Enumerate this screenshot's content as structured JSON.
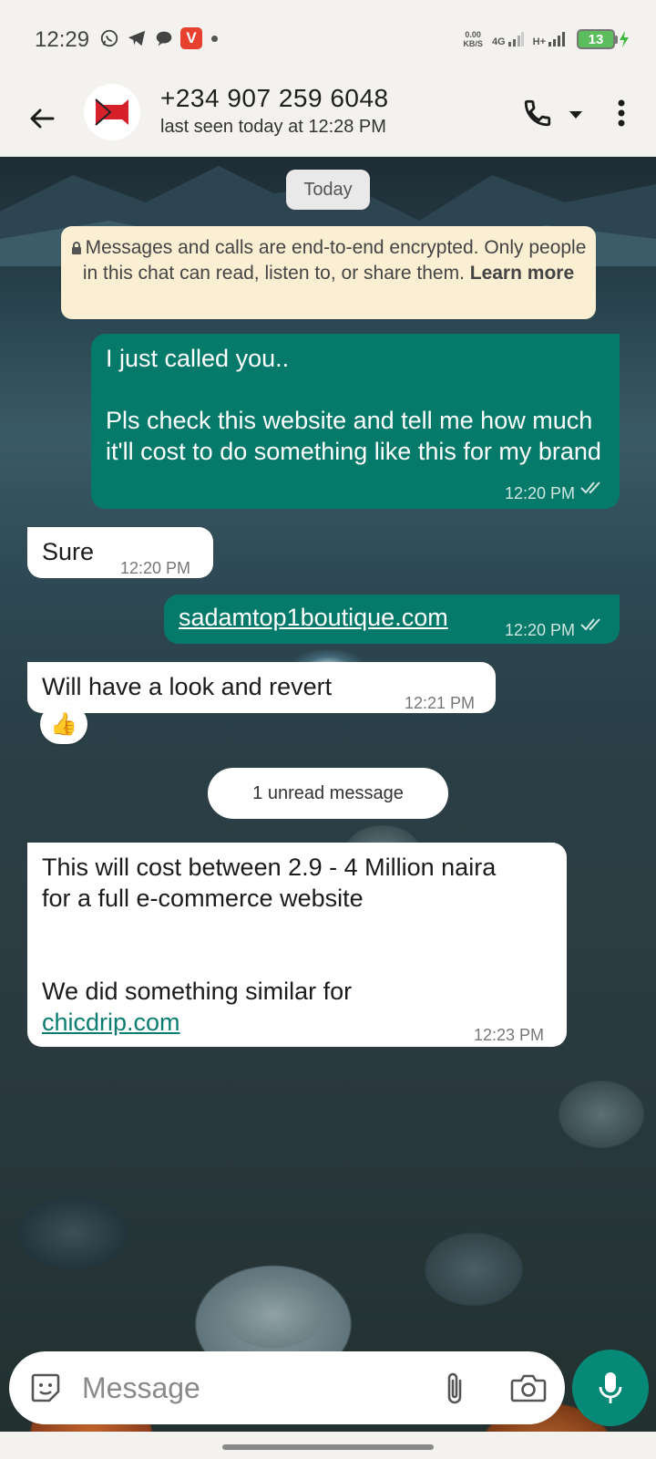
{
  "status_bar": {
    "time": "12:29",
    "speed_top": "0.00",
    "speed_bottom": "KB/S",
    "network_1": "4G",
    "network_2": "H+",
    "battery": "13"
  },
  "header": {
    "contact_name": "+234 907 259 6048",
    "last_seen": "last seen today at 12:28 PM"
  },
  "chat": {
    "date_chip": "Today",
    "encryption_notice": {
      "text": "Messages and calls are end-to-end encrypted. Only people in this chat can read, listen to, or share them.",
      "learn_more": "Learn more"
    },
    "messages": [
      {
        "direction": "out",
        "line1": "I just called you..",
        "line2": "Pls check this website and tell me how much it'll cost to do something like this for my brand",
        "time": "12:20 PM",
        "status": "read"
      },
      {
        "direction": "in",
        "text": "Sure",
        "time": "12:20 PM"
      },
      {
        "direction": "out",
        "link": "sadamtop1boutique.com",
        "time": "12:20 PM",
        "status": "read"
      },
      {
        "direction": "in",
        "text": "Will have a look and revert",
        "time": "12:21 PM",
        "reaction": "👍"
      },
      {
        "direction": "in",
        "line1": "This will cost between 2.9 - 4 Million naira for a full e-commerce website",
        "line2": "We did something similar for",
        "link": "chicdrip.com",
        "time": "12:23 PM"
      }
    ],
    "unread_chip": "1 unread message"
  },
  "input": {
    "placeholder": "Message"
  },
  "colors": {
    "outgoing_bubble": "#067a6a",
    "incoming_bubble": "#ffffff",
    "mic_button": "#068a77",
    "notice_bg": "#fbefd3"
  }
}
